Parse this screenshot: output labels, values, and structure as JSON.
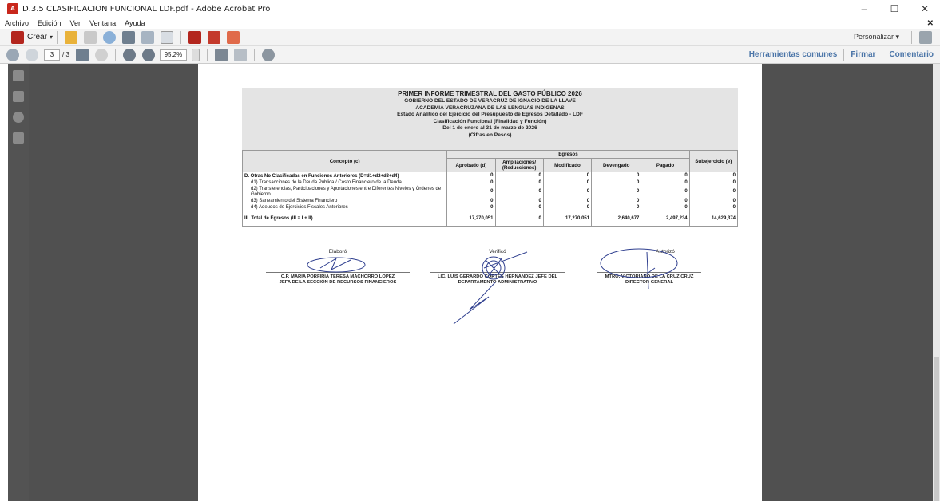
{
  "window": {
    "title": "D.3.5 CLASIFICACION FUNCIONAL LDF.pdf - Adobe Acrobat Pro",
    "app_icon_label": "A",
    "minimize": "–",
    "maximize": "☐",
    "close": "✕"
  },
  "menu": {
    "items": [
      "Archivo",
      "Edición",
      "Ver",
      "Ventana",
      "Ayuda"
    ],
    "close_doc": "✕"
  },
  "toolbar": {
    "create_label": "Crear",
    "create_caret": "▾",
    "personalize_label": "Personalizar ▾"
  },
  "navigation": {
    "current_page": "3",
    "total_pages": "/ 3",
    "zoom": "95.2%",
    "tools": [
      "Herramientas comunes",
      "Firmar",
      "Comentario"
    ]
  },
  "document": {
    "header": [
      "PRIMER INFORME TRIMESTRAL DEL GASTO PÚBLICO 2026",
      "GOBIERNO DEL ESTADO DE VERACRUZ DE IGNACIO DE LA LLAVE",
      "ACADEMIA VERACRUZANA DE LAS LENGUAS INDÍGENAS",
      "Estado Analítico del Ejercicio del Presupuesto de Egresos Detallado - LDF",
      "Clasificación Funcional (Finalidad y Función)",
      "Del 1 de enero al 31 de marzo de 2026",
      "(Cifras en Pesos)"
    ],
    "table": {
      "concept_header": "Concepto (c)",
      "group_header": "Egresos",
      "columns": [
        "Aprobado (d)",
        "Ampliaciones/ (Reducciones)",
        "Modificado",
        "Devengado",
        "Pagado"
      ],
      "last_column": "Subejercicio (e)",
      "rows": [
        {
          "concept": "D. Otras No Clasificadas en Funciones Anteriores (D=d1+d2+d3+d4)",
          "values": [
            "0",
            "0",
            "0",
            "0",
            "0",
            "0"
          ]
        },
        {
          "concept": "d1) Transacciones de la Deuda Publica / Costo Financiero de la Deuda",
          "values": [
            "0",
            "0",
            "0",
            "0",
            "0",
            "0"
          ]
        },
        {
          "concept": "d2) Transferencias, Participaciones y Aportaciones entre Diferentes Niveles y Órdenes de Gobierno",
          "values": [
            "0",
            "0",
            "0",
            "0",
            "0",
            "0"
          ]
        },
        {
          "concept": "d3) Saneamiento del Sistema Financiero",
          "values": [
            "0",
            "0",
            "0",
            "0",
            "0",
            "0"
          ]
        },
        {
          "concept": "d4) Adeudos de Ejercicios Fiscales Anteriores",
          "values": [
            "0",
            "0",
            "0",
            "0",
            "0",
            "0"
          ]
        }
      ],
      "total": {
        "concept": "III. Total de Egresos (III = I + II)",
        "values": [
          "17,270,051",
          "0",
          "17,270,051",
          "2,640,677",
          "2,497,234",
          "14,629,374"
        ]
      }
    },
    "signatures": [
      {
        "caption": "Elaboró",
        "name": "C.P. MARÍA PORFIRIA TERESA MACHORRO LÓPEZ",
        "role": "JEFA DE LA SECCIÓN DE RECURSOS FINANCIEROS"
      },
      {
        "caption": "Verificó",
        "name": "LIC. LUIS GERARDO CORTES HERNÁNDEZ JEFE DEL",
        "role": "DEPARTAMENTO ADMINISTRATIVO"
      },
      {
        "caption": "Autorizó",
        "name": "MTRO. VICTORIANO DE LA CRUZ CRUZ",
        "role": "DIRECTOR GENERAL"
      }
    ]
  }
}
